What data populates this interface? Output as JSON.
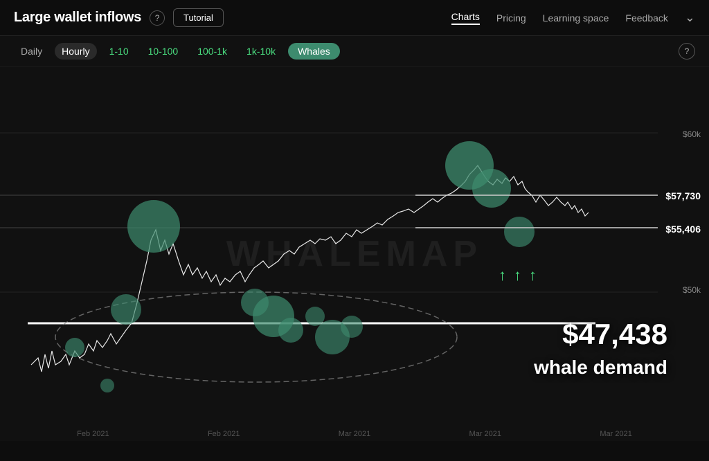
{
  "header": {
    "title": "Large wallet inflows",
    "help_label": "?",
    "tutorial_label": "Tutorial",
    "nav": [
      {
        "label": "Charts",
        "active": true
      },
      {
        "label": "Pricing",
        "active": false
      },
      {
        "label": "Learning space",
        "active": false
      },
      {
        "label": "Feedback",
        "active": false
      }
    ]
  },
  "toolbar": {
    "filters": [
      {
        "label": "Daily",
        "active": false
      },
      {
        "label": "Hourly",
        "active": true
      },
      {
        "label": "1-10",
        "active": false,
        "green": true
      },
      {
        "label": "10-100",
        "active": false,
        "green": true
      },
      {
        "label": "100-1k",
        "active": false,
        "green": true
      },
      {
        "label": "1k-10k",
        "active": false,
        "green": true
      },
      {
        "label": "Whales",
        "active": true,
        "green_filled": true
      }
    ],
    "help_label": "?"
  },
  "chart": {
    "watermark": "WHALEMAP",
    "price_levels": [
      {
        "label": "$60k",
        "position": "top"
      },
      {
        "label": "$57,730",
        "position": "mid_top"
      },
      {
        "label": "$55,406",
        "position": "mid"
      },
      {
        "label": "$50k",
        "position": "lower"
      }
    ],
    "demand_price": "$47,438",
    "demand_label": "whale demand",
    "x_labels": [
      "Feb 2021",
      "Feb 2021",
      "Mar 2021",
      "Mar 2021",
      "Mar 2021"
    ],
    "arrows": [
      "↑",
      "↑",
      "↑"
    ]
  }
}
